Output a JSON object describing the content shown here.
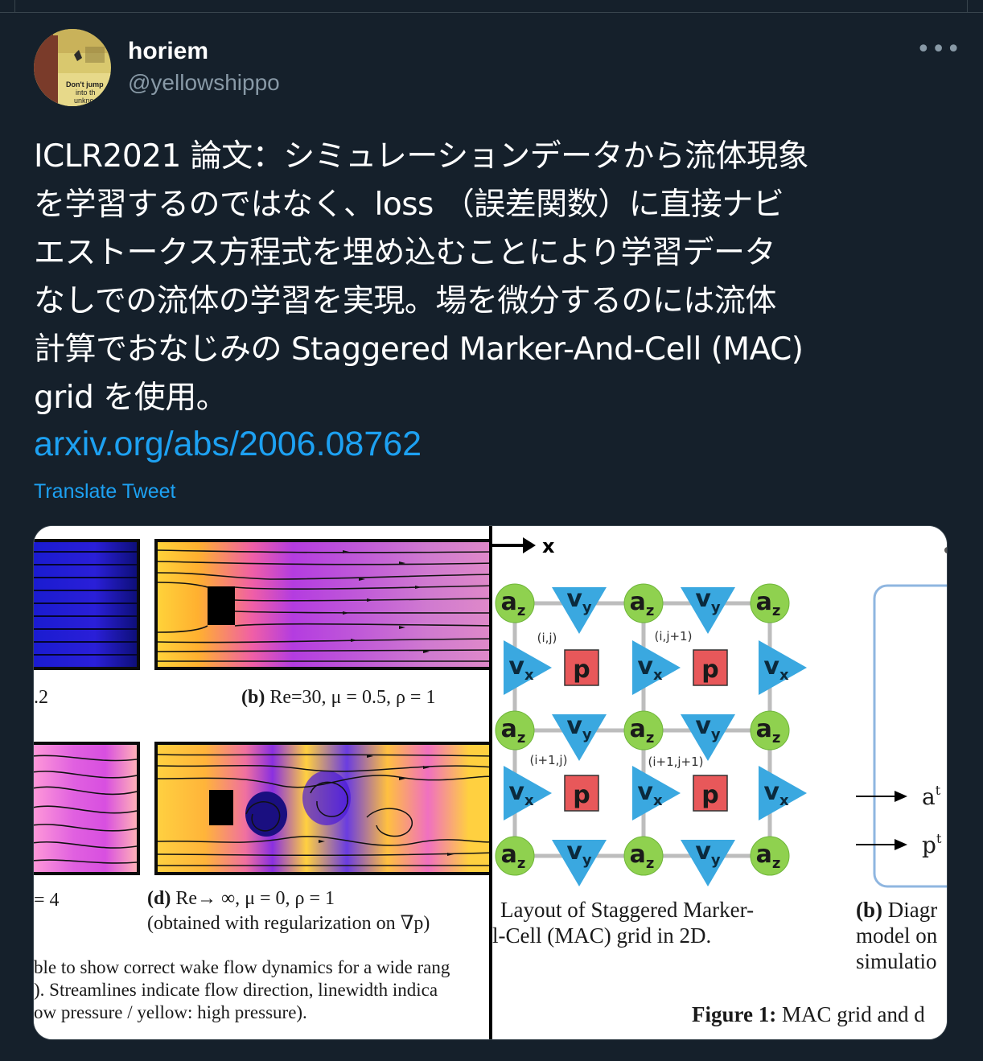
{
  "user": {
    "name": "horiem",
    "handle": "@yellowshippo",
    "avatar_text": [
      "Don't jump",
      "into th",
      "unkno"
    ]
  },
  "more_label": "•••",
  "tweet": {
    "lines": [
      "ICLR2021 論文：シミュレーションデータから流体現象",
      "を学習するのではなく、loss （誤差関数）に直接ナビ",
      "エストークス方程式を埋め込むことにより学習データ",
      "なしでの流体の学習を実現。場を微分するのには流体",
      "計算でおなじみの Staggered Marker-And-Cell (MAC)",
      "grid を使用。"
    ],
    "link": "arxiv.org/abs/2006.08762",
    "translate": "Translate Tweet"
  },
  "media": {
    "left": {
      "label_a": ".2",
      "caption_b_bold": "(b)",
      "caption_b": " Re=30, μ = 0.5, ρ = 1",
      "label_c": "= 4",
      "caption_d_bold": "(d)",
      "caption_d": " Re→ ∞, μ = 0, ρ = 1",
      "caption_d2": "(obtained with regularization on ∇p)",
      "body1": "ble to show correct wake flow dynamics for a wide rang",
      "body2": "). Streamlines indicate flow direction, linewidth indica",
      "body3": "ow pressure / yellow: high pressure)."
    },
    "right": {
      "axis_x": "x",
      "grid_labels": {
        "a": "a",
        "a_sub": "z",
        "vx": "v",
        "vx_sub": "x",
        "vy": "v",
        "vy_sub": "y",
        "p": "p",
        "idx1": "(i,j)",
        "idx2": "(i,j+1)",
        "idx3": "(i+1,j)",
        "idx4": "(i+1,j+1)"
      },
      "caption_a1": "Layout of Staggered Marker-",
      "caption_a2": "l-Cell (MAC) grid in 2D.",
      "caption_b1_bold": "(b)",
      "caption_b1": " Diagr",
      "caption_b2": "model on",
      "caption_b3": "simulatio",
      "arrow1": "a",
      "arrow1_sup": "t",
      "arrow2": "p",
      "arrow2_sup": "t",
      "figure_bold": "Figure 1:",
      "figure_text": " MAC grid and d"
    }
  },
  "colors": {
    "background": "#15202b",
    "accent": "#1da1f2",
    "secondary_text": "#8899a6",
    "border": "#38444d",
    "node_green": "#8fd14f",
    "node_blue": "#3aa8e0",
    "node_red": "#e8585a"
  }
}
